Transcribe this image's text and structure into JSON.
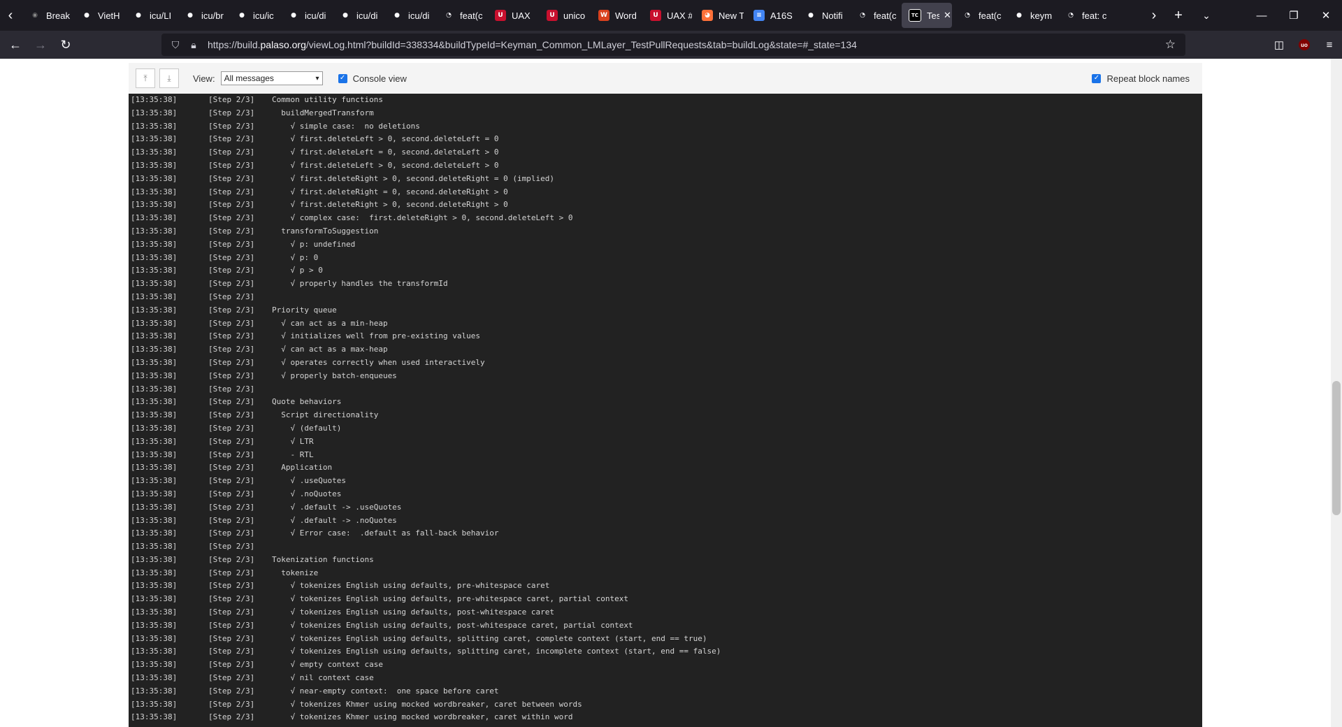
{
  "tabs": [
    {
      "label": "Break",
      "icon": "bug-icon"
    },
    {
      "label": "VietH",
      "icon": "github-icon"
    },
    {
      "label": "icu/LI",
      "icon": "github-icon"
    },
    {
      "label": "icu/br",
      "icon": "github-icon"
    },
    {
      "label": "icu/ic",
      "icon": "github-icon"
    },
    {
      "label": "icu/di",
      "icon": "github-icon"
    },
    {
      "label": "icu/di",
      "icon": "github-icon"
    },
    {
      "label": "icu/di",
      "icon": "github-icon"
    },
    {
      "label": "feat(c",
      "icon": "github-pr-icon"
    },
    {
      "label": "UAX",
      "icon": "unicode-icon"
    },
    {
      "label": "unico",
      "icon": "unicode-icon"
    },
    {
      "label": "Word",
      "icon": "unicode-doc-icon"
    },
    {
      "label": "UAX #",
      "icon": "unicode-icon"
    },
    {
      "label": "New T",
      "icon": "firefox-icon"
    },
    {
      "label": "A16S",
      "icon": "docs-icon"
    },
    {
      "label": "Notifi",
      "icon": "github-icon"
    },
    {
      "label": "feat(c",
      "icon": "github-pr-icon"
    },
    {
      "label": "Test",
      "icon": "teamcity-icon",
      "active": true
    },
    {
      "label": "feat(c",
      "icon": "github-pr-icon"
    },
    {
      "label": "keym",
      "icon": "github-icon"
    },
    {
      "label": "feat: c",
      "icon": "github-pr-icon"
    }
  ],
  "url": {
    "prefix": "https://build.",
    "host": "palaso.org",
    "rest": "/viewLog.html?buildId=338334&buildTypeId=Keyman_Common_LMLayer_TestPullRequests&tab=buildLog&state=#_state=134"
  },
  "toolbar": {
    "view_label": "View:",
    "view_value": "All messages",
    "console_view_label": "Console view",
    "repeat_block_names_label": "Repeat block names"
  },
  "log_time": "[13:35:38]",
  "log_step": "[Step 2/3]",
  "log_lines": [
    "Common utility functions",
    "  buildMergedTransform",
    "    √ simple case:  no deletions",
    "    √ first.deleteLeft > 0, second.deleteLeft = 0",
    "    √ first.deleteLeft = 0, second.deleteLeft > 0",
    "    √ first.deleteLeft > 0, second.deleteLeft > 0",
    "    √ first.deleteRight > 0, second.deleteRight = 0 (implied)",
    "    √ first.deleteRight = 0, second.deleteRight > 0",
    "    √ first.deleteRight > 0, second.deleteRight > 0",
    "    √ complex case:  first.deleteRight > 0, second.deleteLeft > 0",
    "  transformToSuggestion",
    "    √ p: undefined",
    "    √ p: 0",
    "    √ p > 0",
    "    √ properly handles the transformId",
    "",
    "Priority queue",
    "  √ can act as a min-heap",
    "  √ initializes well from pre-existing values",
    "  √ can act as a max-heap",
    "  √ operates correctly when used interactively",
    "  √ properly batch-enqueues",
    "",
    "Quote behaviors",
    "  Script directionality",
    "    √ (default)",
    "    √ LTR",
    "    - RTL",
    "  Application",
    "    √ .useQuotes",
    "    √ .noQuotes",
    "    √ .default -> .useQuotes",
    "    √ .default -> .noQuotes",
    "    √ Error case:  .default as fall-back behavior",
    "",
    "Tokenization functions",
    "  tokenize",
    "    √ tokenizes English using defaults, pre-whitespace caret",
    "    √ tokenizes English using defaults, pre-whitespace caret, partial context",
    "    √ tokenizes English using defaults, post-whitespace caret",
    "    √ tokenizes English using defaults, post-whitespace caret, partial context",
    "    √ tokenizes English using defaults, splitting caret, complete context (start, end == true)",
    "    √ tokenizes English using defaults, splitting caret, incomplete context (start, end == false)",
    "    √ empty context case",
    "    √ nil context case",
    "    √ near-empty context:  one space before caret",
    "    √ tokenizes Khmer using mocked wordbreaker, caret between words",
    "    √ tokenizes Khmer using mocked wordbreaker, caret within word"
  ],
  "colors": {
    "log_background": "#222222",
    "log_text": "#d4d4d4",
    "checkbox": "#1a73e8",
    "tabbar": "#1c1b22",
    "navbar": "#2b2a33"
  }
}
